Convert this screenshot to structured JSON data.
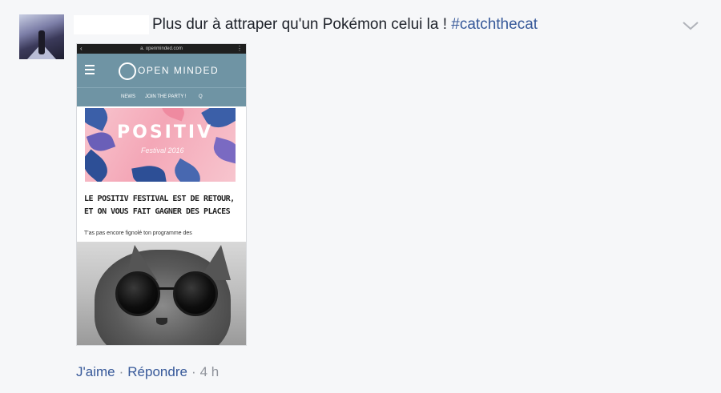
{
  "comment": {
    "text": "Plus dur à attraper qu'un Pokémon celui la ! ",
    "hashtag": "#catchthecat"
  },
  "icons": {
    "avatar": "user-avatar",
    "options": "chevron-down-icon"
  },
  "attachment": {
    "url_bar": "a. openminded.com",
    "site_name": "OPEN MINDED",
    "nav": [
      "NEWS",
      "JOIN THE PARTY !",
      "Q"
    ],
    "banner_title": "POSITIV",
    "banner_subtitle": "Festival 2016",
    "headline": "LE POSITIV FESTIVAL EST DE RETOUR, ET ON VOUS FAIT GAGNER DES PLACES",
    "excerpt": "T'as pas encore fignolé ton programme des"
  },
  "actions": {
    "like": "J'aime",
    "separator": "·",
    "reply": "Répondre",
    "time": "4 h"
  },
  "colors": {
    "link": "#365899",
    "meta": "#90949c",
    "site_header": "#6f94a4"
  }
}
